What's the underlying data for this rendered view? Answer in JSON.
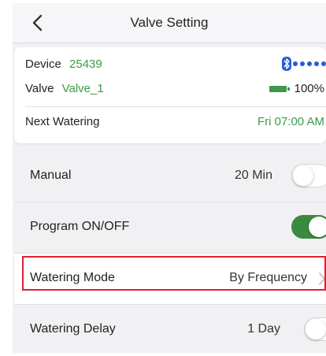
{
  "header": {
    "title": "Valve Setting",
    "back_icon": "chevron-left-icon"
  },
  "device": {
    "device_label": "Device",
    "device_id": "25439",
    "valve_label": "Valve",
    "valve_name": "Valve_1",
    "battery_percent": "100%",
    "battery_level": 1.0,
    "bluetooth_icon": "bluetooth-icon",
    "next_watering_label": "Next Watering",
    "next_watering_value": "Fri 07:00 AM"
  },
  "settings": {
    "manual": {
      "label": "Manual",
      "value": "20 Min",
      "toggle_on": false
    },
    "program": {
      "label": "Program ON/OFF",
      "toggle_on": true
    },
    "watering_mode": {
      "label": "Watering Mode",
      "value": "By Frequency",
      "highlighted": true
    },
    "watering_delay": {
      "label": "Watering Delay",
      "value": "1 Day",
      "toggle_on": false
    }
  },
  "colors": {
    "accent_green": "#3a9a47",
    "toggle_on": "#3a8a3f",
    "highlight_border": "#e02030",
    "bluetooth_blue": "#2a5bd7"
  }
}
